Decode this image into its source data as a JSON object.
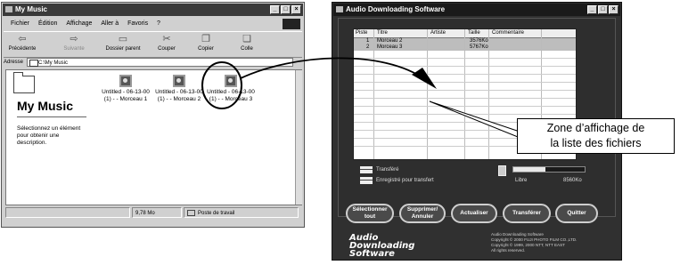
{
  "explorer": {
    "title": "My Music",
    "window_buttons": [
      "_",
      "□",
      "×"
    ],
    "menu": [
      "Fichier",
      "Édition",
      "Affichage",
      "Aller à",
      "Favoris",
      "?"
    ],
    "toolbar": [
      {
        "label": "Précédente",
        "icon": "back-arrow-icon",
        "glyph": "⇦"
      },
      {
        "label": "Suivante",
        "icon": "forward-arrow-icon",
        "glyph": "⇨"
      },
      {
        "label": "Dossier parent",
        "icon": "folder-up-icon",
        "glyph": "▭"
      },
      {
        "label": "Couper",
        "icon": "scissors-icon",
        "glyph": "✂"
      },
      {
        "label": "Copier",
        "icon": "copy-icon",
        "glyph": "❐"
      },
      {
        "label": "Colle",
        "icon": "paste-icon",
        "glyph": "❏"
      }
    ],
    "address_label": "Adresse",
    "address_value": "C:\\My Music",
    "folder_title": "My Music",
    "folder_description": "Sélectionnez un élément pour obtenir une description.",
    "files": [
      {
        "line1": "Untitled - 06-13-00",
        "line2": "(1) - - Morceau 1"
      },
      {
        "line1": "Untitled - 06-13-00",
        "line2": "(1) - - Morceau 2"
      },
      {
        "line1": "Untitled - 06-13-00",
        "line2": "(1) - - Morceau 3"
      }
    ],
    "status_size": "9,78 Mo",
    "status_location": "Poste de travail"
  },
  "callout": {
    "line1": "Zone d’affichage de",
    "line2": "la liste des fichiers"
  },
  "audio": {
    "title": "Audio Downloading Software",
    "columns": [
      "Piste",
      "Titre",
      "Artiste",
      "Taille",
      "Commentaire"
    ],
    "rows": [
      {
        "piste": "1",
        "titre": "Morceau 2",
        "artiste": "",
        "taille": "3576Ko",
        "commentaire": ""
      },
      {
        "piste": "2",
        "titre": "Morceau 3",
        "artiste": "",
        "taille": "5767Ko",
        "commentaire": ""
      }
    ],
    "legend_transferred": "Transféré",
    "legend_recorded": "Enregistré pour transfert",
    "free_label": "Libre",
    "free_value": "8560Ko",
    "free_fraction": 0.45,
    "buttons": {
      "select_all_l1": "Sélectionner",
      "select_all_l2": "tout",
      "delete_l1": "Supprimer/",
      "delete_l2": "Annuler",
      "refresh": "Actualiser",
      "transfer": "Transférer",
      "quit": "Quitter"
    },
    "logo_l1": "Audio",
    "logo_l2": "Downloading",
    "logo_l3": "Software",
    "copyright": [
      "Audio Downloading Software",
      "Copyright © 2000 FUJI PHOTO FILM CO.,LTD.",
      "Copyright © 1999, 2000 NTT, NTT EAST",
      "All rights reserved."
    ]
  }
}
